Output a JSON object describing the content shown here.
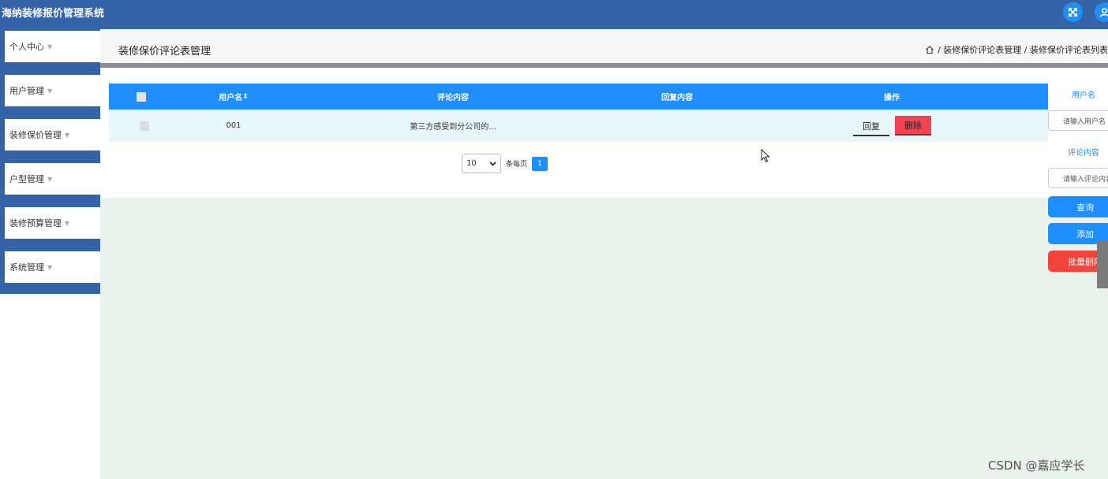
{
  "app": {
    "title": "海纳装修报价管理系统"
  },
  "topbar": {
    "icons": [
      "fullscreen-icon",
      "user-icon"
    ],
    "accent": "#1f8ffb"
  },
  "sidebar": {
    "items": [
      {
        "label": "个人中心"
      },
      {
        "label": "用户管理"
      },
      {
        "label": "装修保价管理"
      },
      {
        "label": "户型管理"
      },
      {
        "label": "装修预算管理"
      },
      {
        "label": "系统管理"
      }
    ],
    "caret": "▼"
  },
  "header": {
    "title": "装修保价评论表管理",
    "breadcrumb": "/ 装修保价评论表管理 / 装修保价评论表列表"
  },
  "table": {
    "columns": [
      "用户名",
      "评论内容",
      "回复内容",
      "操作"
    ],
    "sort_glyph": "⇕",
    "rows": [
      {
        "username": "001",
        "comment": "第三方感受到分公司的...",
        "reply": "",
        "reply_button": "回复",
        "delete_button": "删除"
      }
    ]
  },
  "pagination": {
    "page_size": "10",
    "per_page_label": "条每页",
    "current_page": "1"
  },
  "search": {
    "username_label": "用户名",
    "username_placeholder": "请输入用户名",
    "comment_label": "评论内容",
    "comment_placeholder": "请输入评论内容",
    "query_button": "查询",
    "add_button": "添加",
    "batch_delete_button": "批量删除"
  },
  "colors": {
    "topbar": "#3563a8",
    "primary": "#1e8ffd",
    "danger": "#f34352",
    "row_bg": "#e8f7f9",
    "page_bg": "#e9f2ed"
  },
  "watermark": "CSDN @嘉应学长"
}
